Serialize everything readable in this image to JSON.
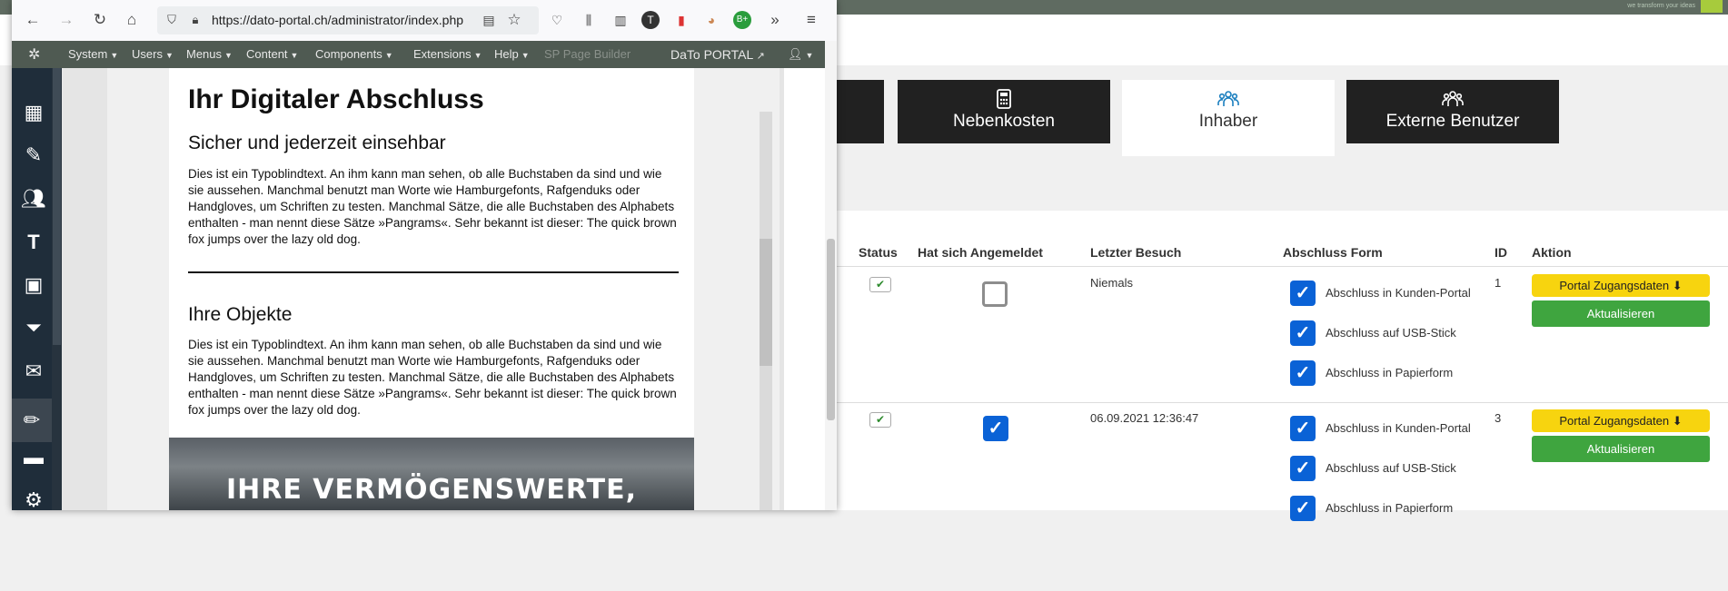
{
  "background": {
    "tabs": [
      {
        "label": "",
        "icon": "partial-tab"
      },
      {
        "label": "Nebenkosten",
        "icon": "calculator-icon"
      },
      {
        "label": "Inhaber",
        "icon": "group-icon"
      },
      {
        "label": "Externe Benutzer",
        "icon": "group-icon"
      }
    ],
    "table": {
      "headers": [
        "Status",
        "Hat sich Angemeldet",
        "Letzter Besuch",
        "Abschluss Form",
        "ID",
        "Aktion"
      ],
      "rows": [
        {
          "last_visit": "Niemals",
          "id": "1",
          "logged_in": false,
          "forms": [
            "Abschluss in Kunden-Portal",
            "Abschluss auf USB-Stick",
            "Abschluss in Papierform"
          ],
          "btn_access": "Portal Zugangsdaten",
          "btn_update": "Aktualisieren"
        },
        {
          "last_visit": "06.09.2021 12:36:47",
          "id": "3",
          "logged_in": true,
          "forms": [
            "Abschluss in Kunden-Portal",
            "Abschluss auf USB-Stick",
            "Abschluss in Papierform"
          ],
          "btn_access": "Portal Zugangsdaten",
          "btn_update": "Aktualisieren"
        }
      ]
    },
    "brand_text": "we transform your ideas"
  },
  "browser": {
    "url": "https://dato-portal.ch/administrator/index.php",
    "nav": {
      "items": [
        "System",
        "Users",
        "Menus",
        "Content",
        "Components",
        "Extensions",
        "Help"
      ],
      "disabled_item": "SP Page Builder",
      "site_link": "DaTo PORTAL"
    },
    "page": {
      "title": "Ihr Digitaler Abschluss",
      "subtitle": "Sicher und jederzeit einsehbar",
      "paragraph1": "Dies ist ein Typoblindtext. An ihm kann man sehen, ob alle Buchstaben da sind und wie sie aussehen. Manchmal benutzt man Worte wie Hamburgefonts, Rafgenduks oder Handgloves, um Schriften zu testen. Manchmal Sätze, die alle Buchstaben des Alphabets enthalten - man nennt diese Sätze »Pangrams«. Sehr bekannt ist dieser: The quick brown fox jumps over the lazy old dog.",
      "section2": "Ihre Objekte",
      "paragraph2": "Dies ist ein Typoblindtext. An ihm kann man sehen, ob alle Buchstaben da sind und wie sie aussehen. Manchmal benutzt man Worte wie Hamburgefonts, Rafgenduks oder Handgloves, um Schriften zu testen. Manchmal Sätze, die alle Buchstaben des Alphabets enthalten - man nennt diese Sätze »Pangrams«. Sehr bekannt ist dieser: The quick brown fox jumps over the lazy old dog.",
      "banner_text": "IHRE VERMÖGENSWERTE,"
    }
  },
  "colors": {
    "accent_blue": "#0a62d6",
    "yellow": "#f7d40f",
    "green": "#3fa53f",
    "dark_tab": "#212121"
  }
}
